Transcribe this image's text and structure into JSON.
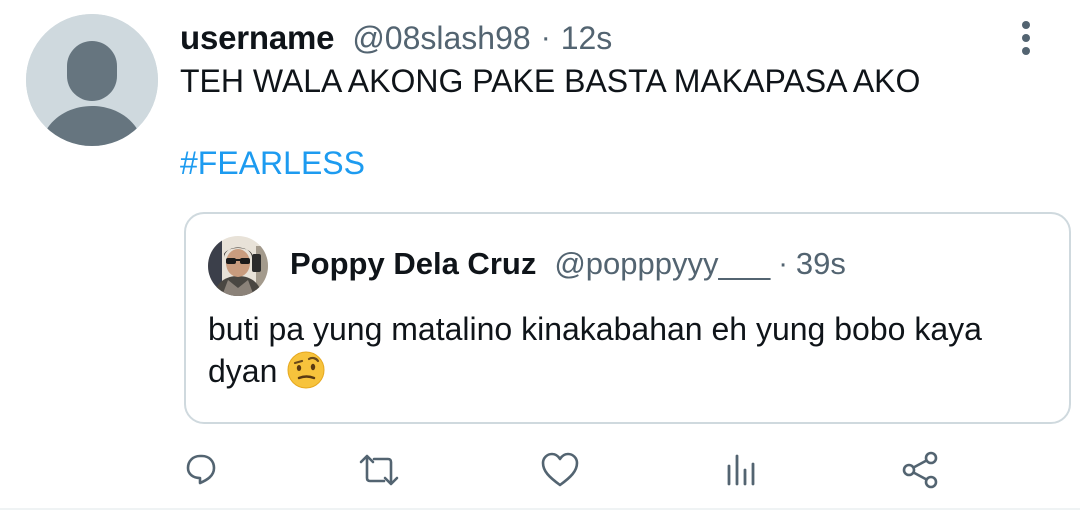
{
  "tweet": {
    "display_name": "username",
    "handle": "@08slash98",
    "separator": "·",
    "time": "12s",
    "text": "TEH WALA AKONG PAKE BASTA MAKAPASA AKO",
    "hashtag": "#FEARLESS",
    "link_color": "#1d9bf0"
  },
  "quote": {
    "display_name": "Poppy Dela Cruz",
    "handle": "@popppyyy___",
    "separator": "·",
    "time": "39s",
    "text": "buti pa yung matalino kinakabahan eh yung bobo kaya dyan",
    "emoji": "face-with-raised-eyebrow"
  },
  "actions": [
    {
      "name": "reply",
      "icon": "reply-icon"
    },
    {
      "name": "retweet",
      "icon": "retweet-icon"
    },
    {
      "name": "like",
      "icon": "heart-icon"
    },
    {
      "name": "analytics",
      "icon": "analytics-icon"
    },
    {
      "name": "share",
      "icon": "share-icon"
    }
  ],
  "colors": {
    "text_primary": "#0f1419",
    "text_secondary": "#536471",
    "border": "#cfd9de"
  }
}
